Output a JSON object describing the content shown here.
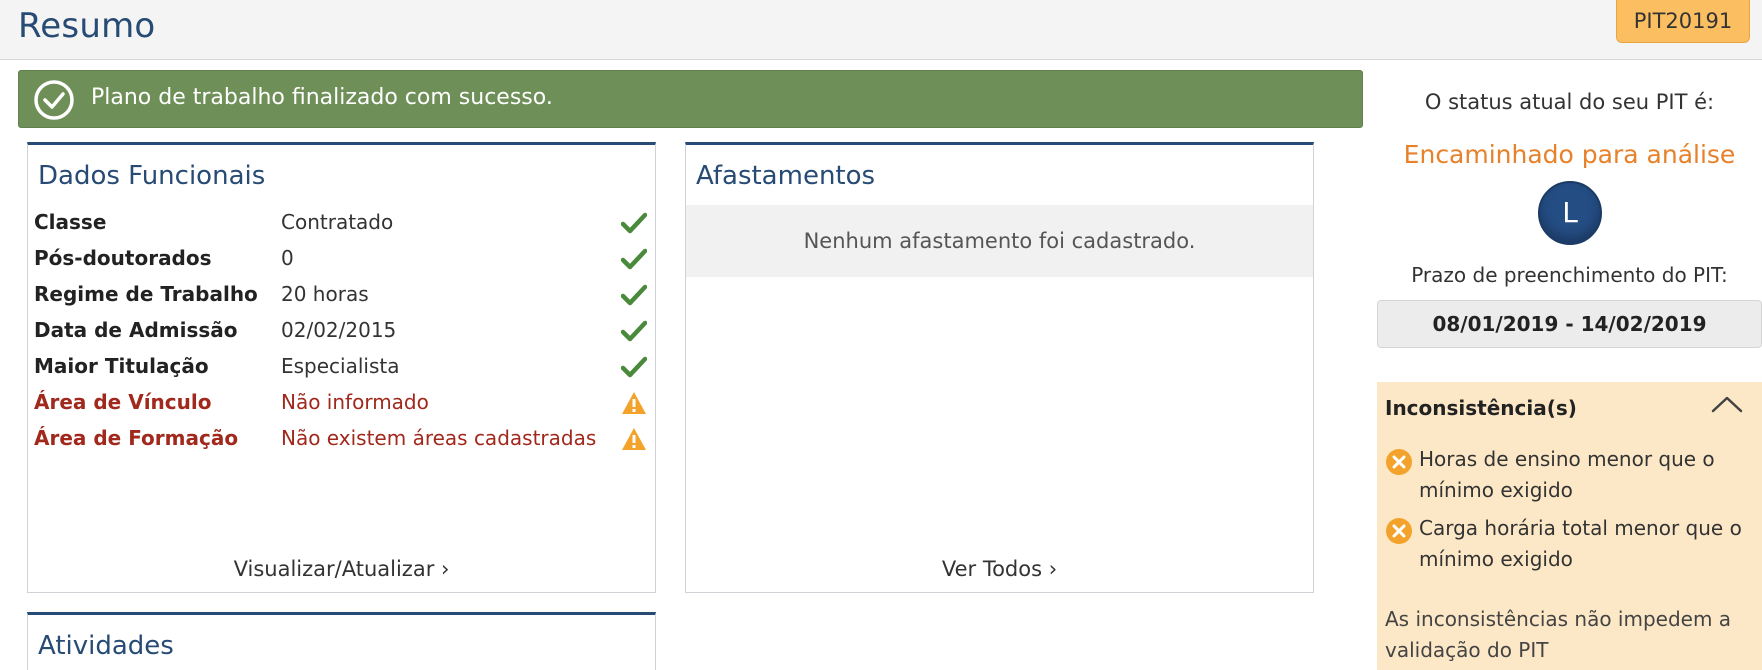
{
  "header": {
    "title": "Resumo",
    "pit_code": "PIT20191"
  },
  "alert": {
    "message": "Plano de trabalho finalizado com sucesso.",
    "icon": "check-circle-icon"
  },
  "dados_funcionais": {
    "title": "Dados Funcionais",
    "rows": [
      {
        "label": "Classe",
        "value": "Contratado",
        "status": "ok"
      },
      {
        "label": "Pós-doutorados",
        "value": "0",
        "status": "ok"
      },
      {
        "label": "Regime de Trabalho",
        "value": "20 horas",
        "status": "ok"
      },
      {
        "label": "Data de Admissão",
        "value": "02/02/2015",
        "status": "ok"
      },
      {
        "label": "Maior Titulação",
        "value": "Especialista",
        "status": "ok"
      },
      {
        "label": "Área de Vínculo",
        "value": "Não informado",
        "status": "warning"
      },
      {
        "label": "Área de Formação",
        "value": "Não existem áreas cadastradas",
        "status": "warning"
      }
    ],
    "link": "Visualizar/Atualizar ›"
  },
  "afastamentos": {
    "title": "Afastamentos",
    "empty_message": "Nenhum afastamento foi cadastrado.",
    "link": "Ver Todos ›"
  },
  "atividades": {
    "title": "Atividades"
  },
  "status": {
    "caption": "O status atual do seu PIT é:",
    "value": "Encaminhado para análise",
    "avatar_letter": "L"
  },
  "deadline": {
    "caption": "Prazo de preenchimento do PIT:",
    "range": "08/01/2019 - 14/02/2019"
  },
  "inconsistencias": {
    "title": "Inconsistência(s)",
    "items": [
      "Horas de ensino menor que o mínimo exigido",
      "Carga horária total menor que o mínimo exigido"
    ],
    "note": "As inconsistências não impedem a validação do PIT"
  },
  "colors": {
    "brand_blue": "#274b74",
    "success_green": "#6f8f58",
    "status_orange": "#e7812a",
    "warning_red": "#a1281c",
    "badge_orange": "#fbbf62",
    "check_green": "#4a8a3c",
    "warning_amber": "#f3a32b"
  }
}
